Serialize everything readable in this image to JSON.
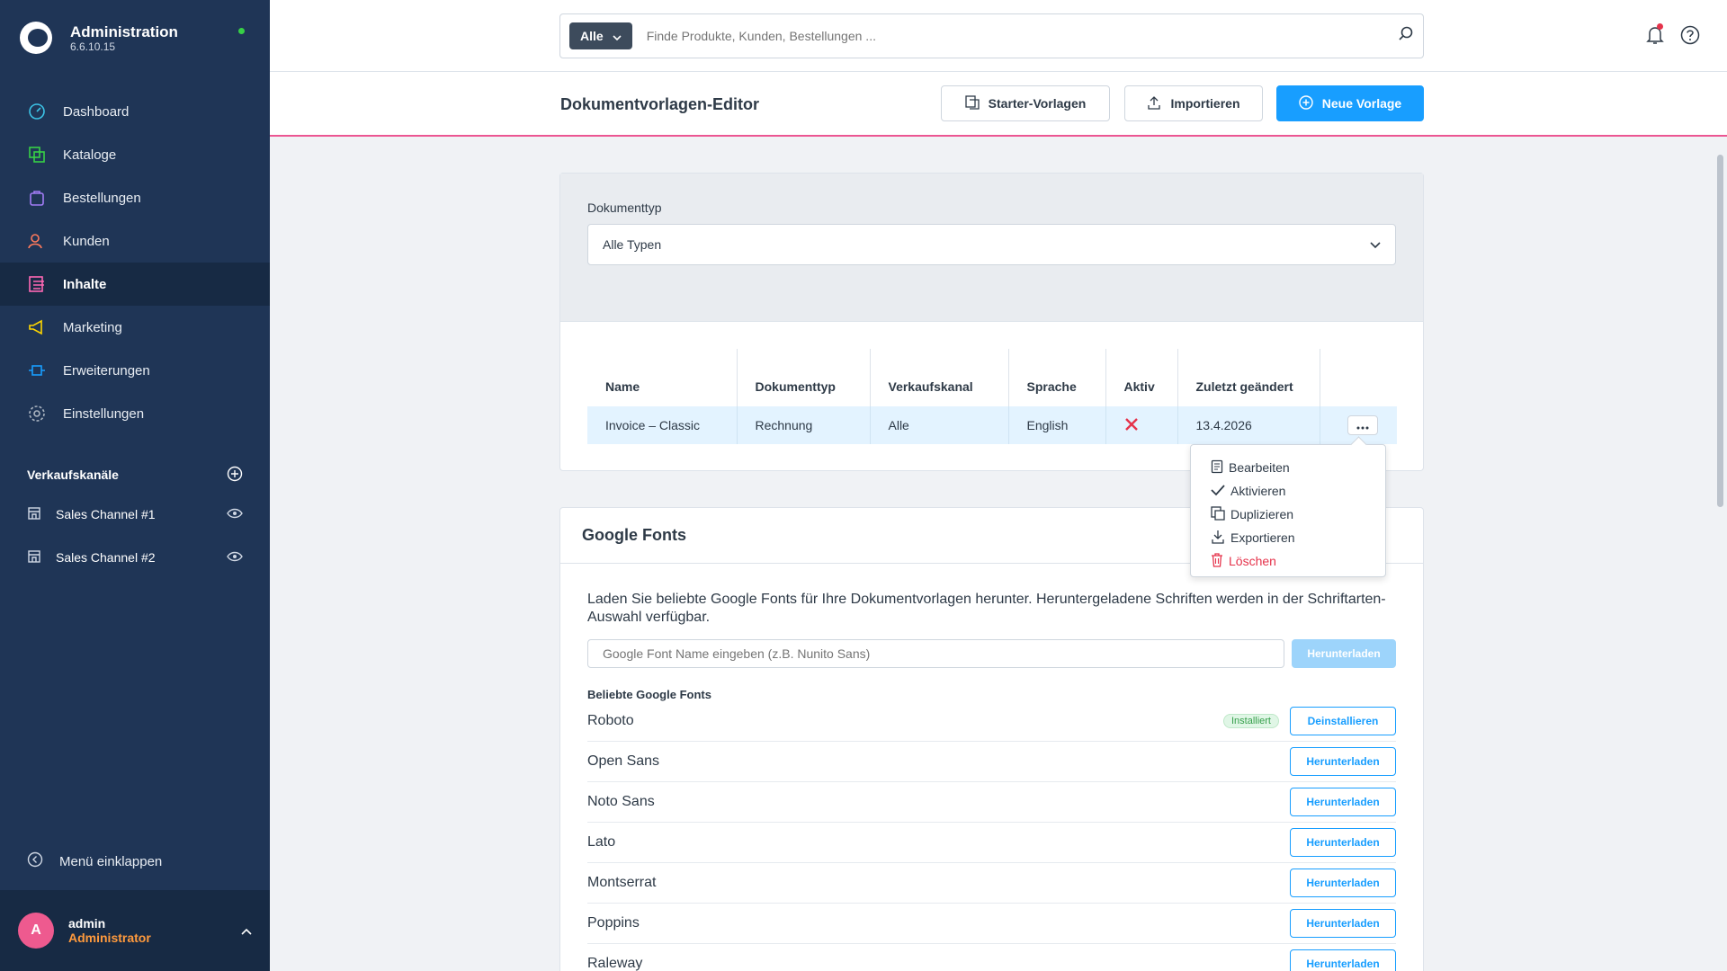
{
  "colors": {
    "accent": "#189eff",
    "sidebar": "#1f3556",
    "danger": "#e5334b",
    "page_border": "#ec5592"
  },
  "app": {
    "title": "Administration",
    "version": "6.6.10.15"
  },
  "nav": [
    {
      "label": "Dashboard",
      "icon": "dashboard-icon"
    },
    {
      "label": "Kataloge",
      "icon": "catalog-icon"
    },
    {
      "label": "Bestellungen",
      "icon": "orders-icon"
    },
    {
      "label": "Kunden",
      "icon": "customers-icon"
    },
    {
      "label": "Inhalte",
      "icon": "content-icon",
      "active": true
    },
    {
      "label": "Marketing",
      "icon": "megaphone-icon"
    },
    {
      "label": "Erweiterungen",
      "icon": "plugin-icon"
    },
    {
      "label": "Einstellungen",
      "icon": "gear-icon"
    }
  ],
  "sales_channels": {
    "title": "Verkaufskanäle",
    "items": [
      "Sales Channel #1",
      "Sales Channel #2"
    ]
  },
  "collapse_label": "Menü einklappen",
  "user": {
    "initial": "A",
    "name": "admin",
    "role": "Administrator"
  },
  "search": {
    "scope": "Alle",
    "placeholder": "Finde Produkte, Kunden, Bestellungen ..."
  },
  "page": {
    "title": "Dokumentvorlagen-Editor",
    "btn_starter": "Starter-Vorlagen",
    "btn_import": "Importieren",
    "btn_new": "Neue Vorlage"
  },
  "filter": {
    "label": "Dokumenttyp",
    "value": "Alle Typen"
  },
  "table": {
    "headers": [
      "Name",
      "Dokumenttyp",
      "Verkaufskanal",
      "Sprache",
      "Aktiv",
      "Zuletzt geändert"
    ],
    "rows": [
      {
        "name": "Invoice – Classic",
        "type": "Rechnung",
        "channel": "Alle",
        "language": "English",
        "active": false,
        "modified": "13.4.2026"
      }
    ]
  },
  "context_menu": [
    "Bearbeiten",
    "Aktivieren",
    "Duplizieren",
    "Exportieren",
    "Löschen"
  ],
  "google_fonts": {
    "title": "Google Fonts",
    "description": "Laden Sie beliebte Google Fonts für Ihre Dokumentvorlagen herunter. Heruntergeladene Schriften werden in der Schriftarten-Auswahl verfügbar.",
    "input_placeholder": "Google Font Name eingeben (z.B. Nunito Sans)",
    "download_label": "Herunterladen",
    "popular_title": "Beliebte Google Fonts",
    "installed_badge": "Installiert",
    "uninstall_label": "Deinstallieren",
    "fonts": [
      {
        "name": "Roboto",
        "installed": true
      },
      {
        "name": "Open Sans",
        "installed": false
      },
      {
        "name": "Noto Sans",
        "installed": false
      },
      {
        "name": "Lato",
        "installed": false
      },
      {
        "name": "Montserrat",
        "installed": false
      },
      {
        "name": "Poppins",
        "installed": false
      },
      {
        "name": "Raleway",
        "installed": false
      }
    ]
  }
}
